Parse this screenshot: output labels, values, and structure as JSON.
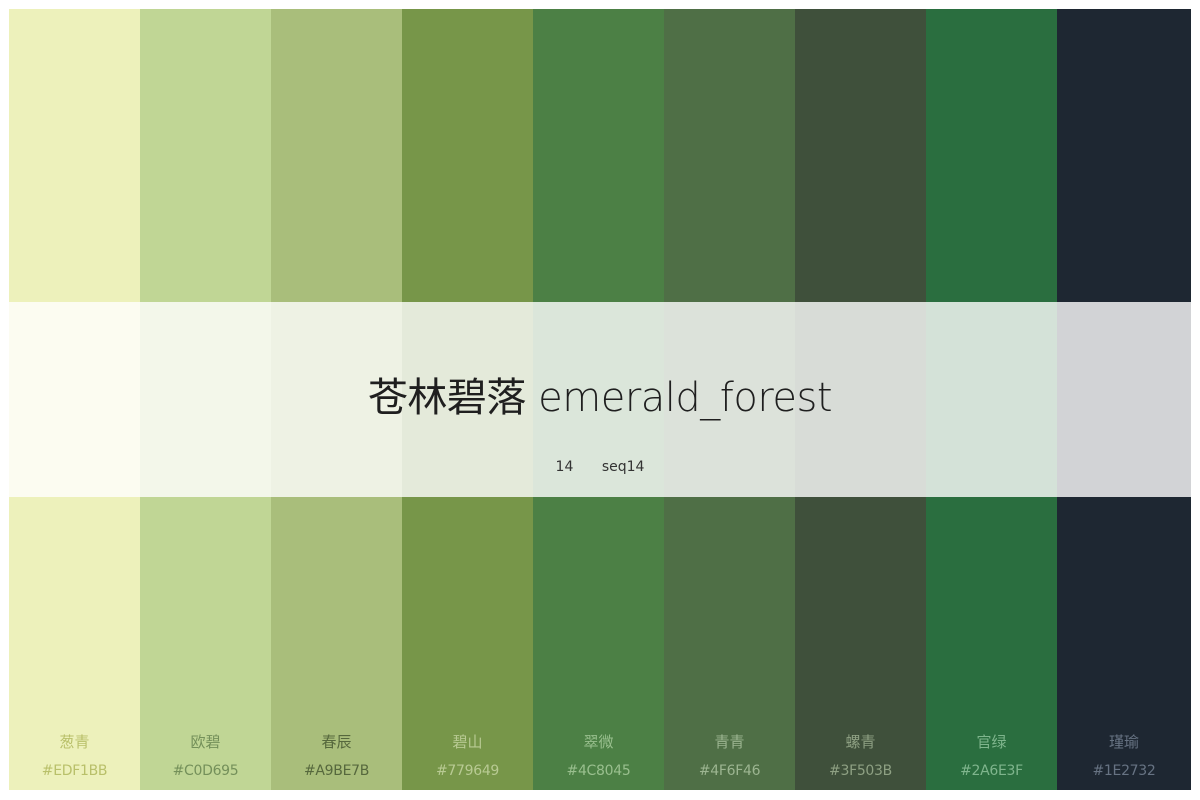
{
  "palette": {
    "title": "苍林碧落 emerald_forest",
    "count": "14",
    "code": "seq14",
    "colors": [
      {
        "name": "葱青",
        "hex": "#EDF1BB",
        "bg": "#EDF1BB",
        "text": "#B9C06A"
      },
      {
        "name": "欧碧",
        "hex": "#C0D695",
        "bg": "#C0D695",
        "text": "#74905A"
      },
      {
        "name": "春辰",
        "hex": "#A9BE7B",
        "bg": "#A9BE7B",
        "text": "#56683D"
      },
      {
        "name": "碧山",
        "hex": "#779649",
        "bg": "#779649",
        "text": "#B8CA93"
      },
      {
        "name": "翠微",
        "hex": "#4C8045",
        "bg": "#4C8045",
        "text": "#99BF8E"
      },
      {
        "name": "青青",
        "hex": "#4F6F46",
        "bg": "#4F6F46",
        "text": "#9CB591"
      },
      {
        "name": "螺青",
        "hex": "#3F503B",
        "bg": "#3F503B",
        "text": "#8EA083"
      },
      {
        "name": "官绿",
        "hex": "#2A6E3F",
        "bg": "#2A6E3F",
        "text": "#7FB58D"
      },
      {
        "name": "瑾瑜",
        "hex": "#1E2732",
        "bg": "#1E2732",
        "text": "#677383"
      }
    ]
  }
}
